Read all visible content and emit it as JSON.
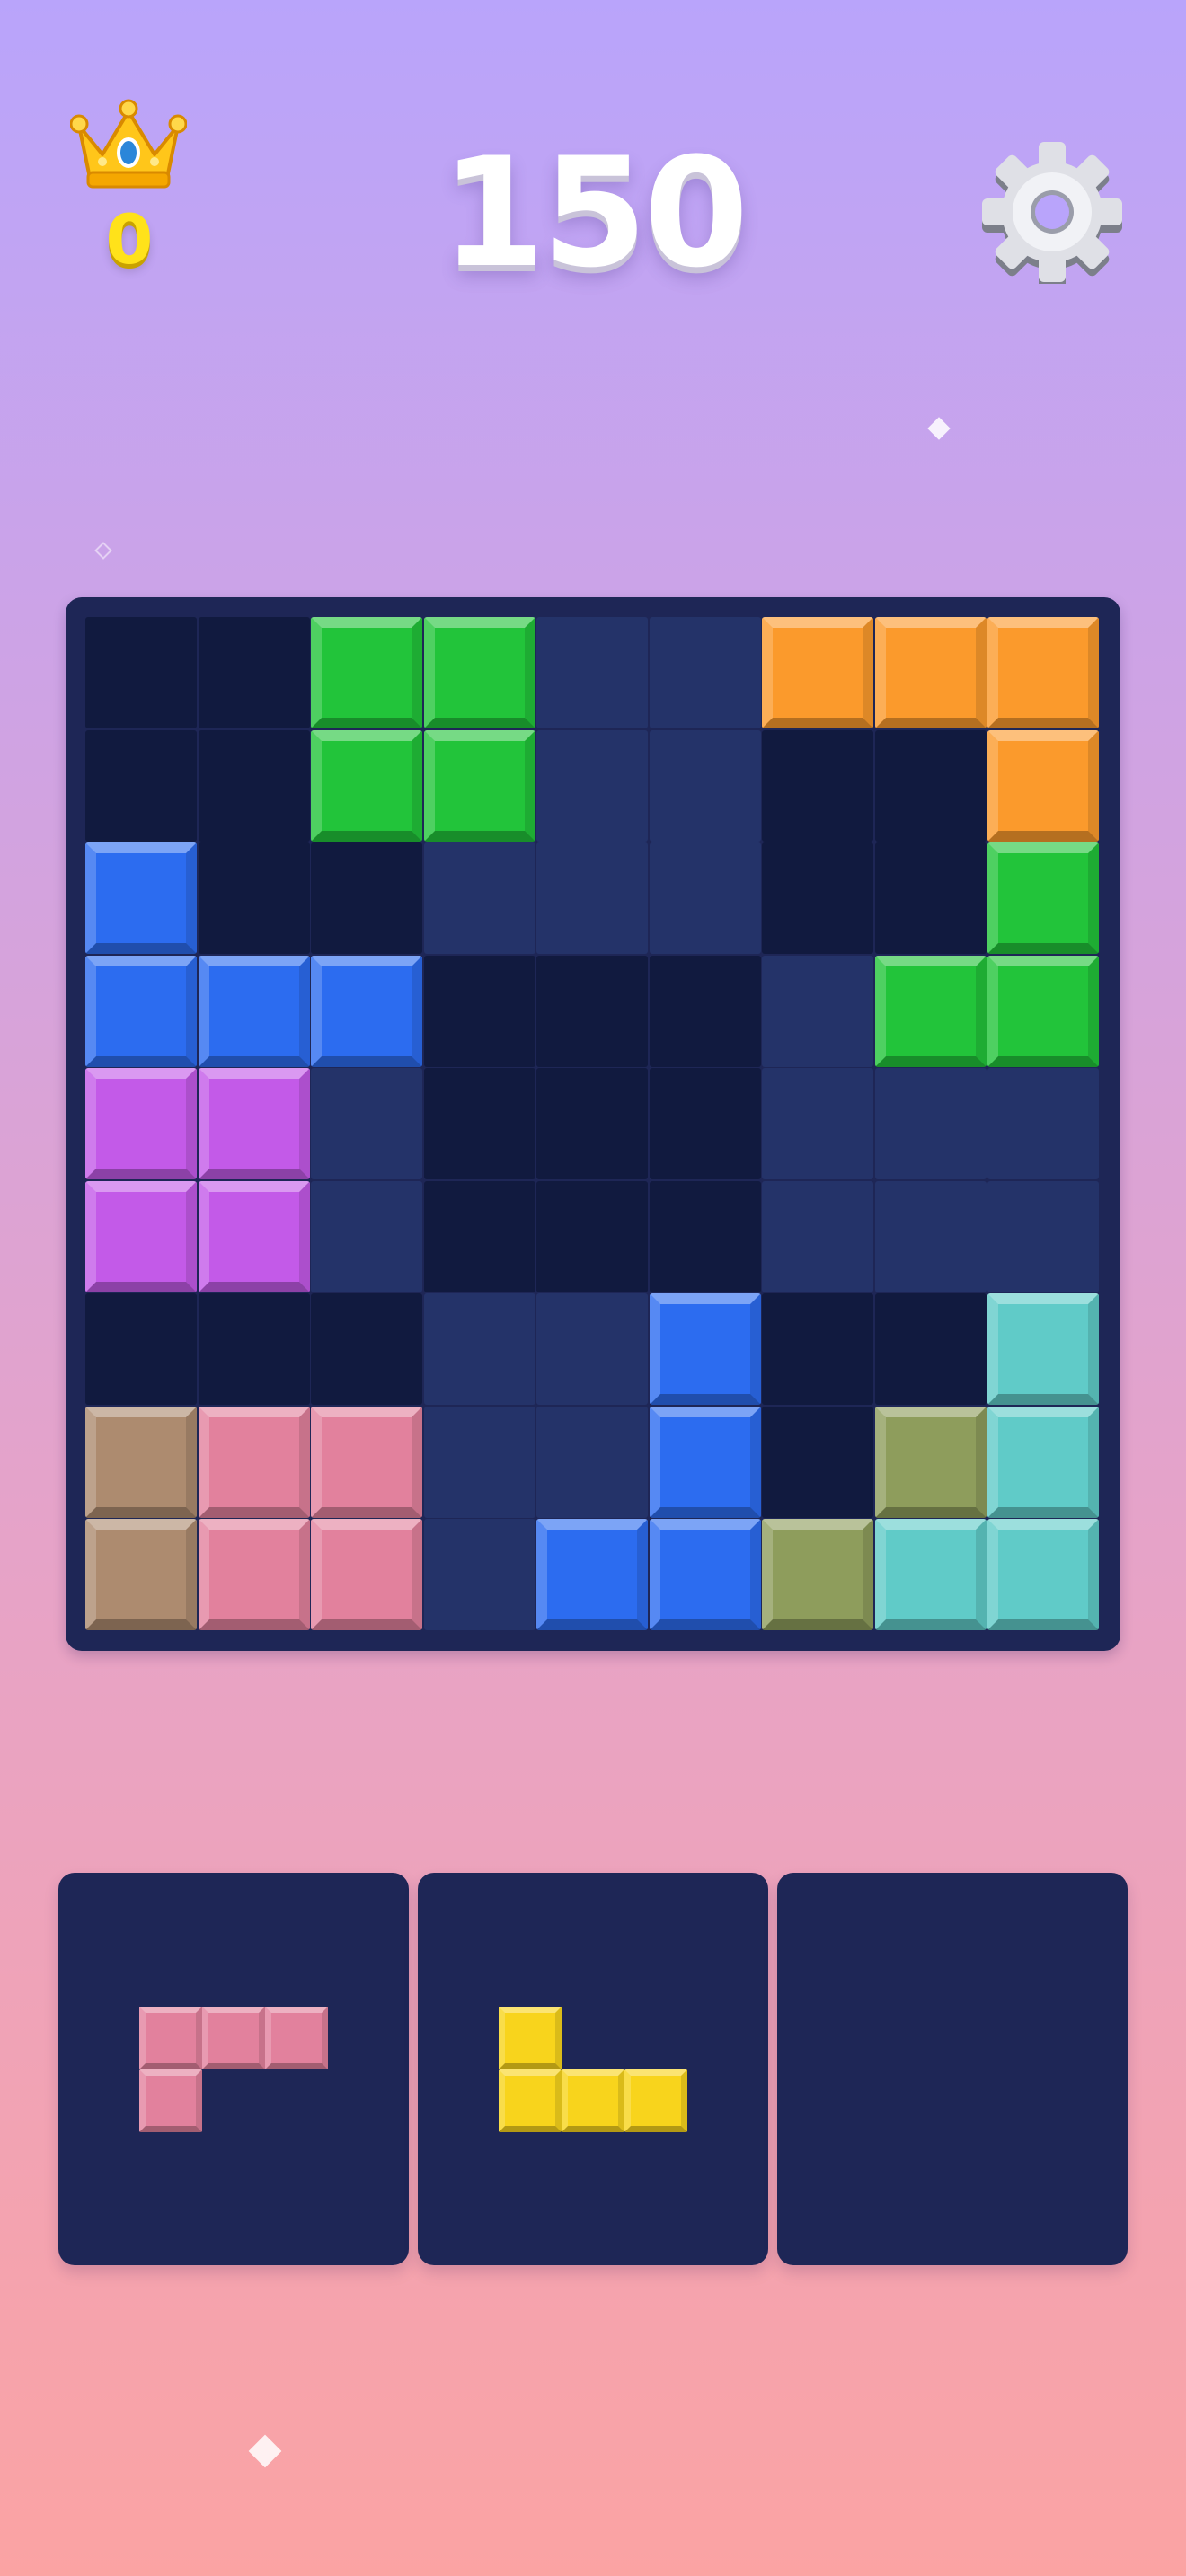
{
  "header": {
    "best_score": "0",
    "score": "150",
    "crown_icon": "crown-icon",
    "settings_icon": "gear-icon"
  },
  "colors": {
    "green": "#22c43a",
    "orange": "#fb9a2c",
    "blue": "#2c6cf0",
    "purple": "#c35ae8",
    "teal": "#60cbc8",
    "tan": "#ad8b6f",
    "pink": "#e2819d",
    "olive": "#8e9d5c",
    "yellow": "#f8d41c",
    "empty": "#111a3f",
    "highlight": "#243369"
  },
  "board": {
    "rows": [
      [
        "empty",
        "empty",
        "green",
        "green",
        "highlight",
        "highlight",
        "orange",
        "orange",
        "orange"
      ],
      [
        "empty",
        "empty",
        "green",
        "green",
        "highlight",
        "highlight",
        "empty",
        "empty",
        "orange"
      ],
      [
        "blue",
        "empty",
        "empty",
        "highlight",
        "highlight",
        "highlight",
        "empty",
        "empty",
        "green"
      ],
      [
        "blue",
        "blue",
        "blue",
        "empty",
        "empty",
        "empty",
        "highlight",
        "green",
        "green"
      ],
      [
        "purple",
        "purple",
        "highlight",
        "empty",
        "empty",
        "empty",
        "highlight",
        "highlight",
        "highlight"
      ],
      [
        "purple",
        "purple",
        "highlight",
        "empty",
        "empty",
        "empty",
        "highlight",
        "highlight",
        "highlight"
      ],
      [
        "empty",
        "empty",
        "empty",
        "highlight",
        "highlight",
        "blue",
        "empty",
        "empty",
        "teal"
      ],
      [
        "tan",
        "pink",
        "pink",
        "highlight",
        "highlight",
        "blue",
        "empty",
        "olive",
        "teal"
      ],
      [
        "tan",
        "pink",
        "pink",
        "highlight",
        "blue",
        "blue",
        "olive",
        "teal",
        "teal"
      ]
    ]
  },
  "tray": [
    {
      "color": "pink",
      "cells": [
        [
          0,
          0
        ],
        [
          0,
          1
        ],
        [
          0,
          2
        ],
        [
          1,
          0
        ]
      ]
    },
    {
      "color": "yellow",
      "cells": [
        [
          0,
          0
        ],
        [
          1,
          0
        ],
        [
          1,
          1
        ],
        [
          1,
          2
        ]
      ]
    },
    {
      "color": null,
      "cells": []
    }
  ]
}
